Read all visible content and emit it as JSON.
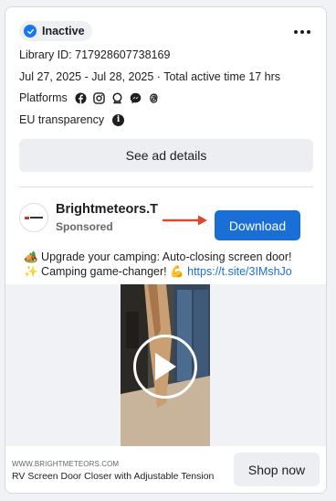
{
  "status": {
    "label": "Inactive",
    "icon": "check-circle-icon",
    "color": "#1877f2"
  },
  "menu": {
    "icon": "more-options-icon"
  },
  "library_id": "Library ID: 717928607738169",
  "date_range": "Jul 27, 2025 - Jul 28, 2025 · Total active time 17 hrs",
  "platforms": {
    "label": "Platforms",
    "icons": [
      "facebook-icon",
      "instagram-icon",
      "audience-network-icon",
      "messenger-icon",
      "threads-icon"
    ]
  },
  "eu_transparency": {
    "label": "EU transparency",
    "icon": "info-icon"
  },
  "details_button": "See ad details",
  "ad": {
    "advertiser": "Brightmeteors.T",
    "sponsored": "Sponsored",
    "cta_button": "Download",
    "cta_color": "#1a6fd6",
    "arrow_color": "#e0462f",
    "line1": "🏕️ Upgrade your camping: Auto-closing screen door!",
    "line2_prefix": "✨ Camping game-changer! 💪 ",
    "line2_link": "https://t.site/3IMshJo",
    "video_icon": "play-icon",
    "domain": "WWW.BRIGHTMETEORS.COM",
    "product_title": "RV Screen Door Closer with Adjustable Tension",
    "shop_button": "Shop now"
  }
}
